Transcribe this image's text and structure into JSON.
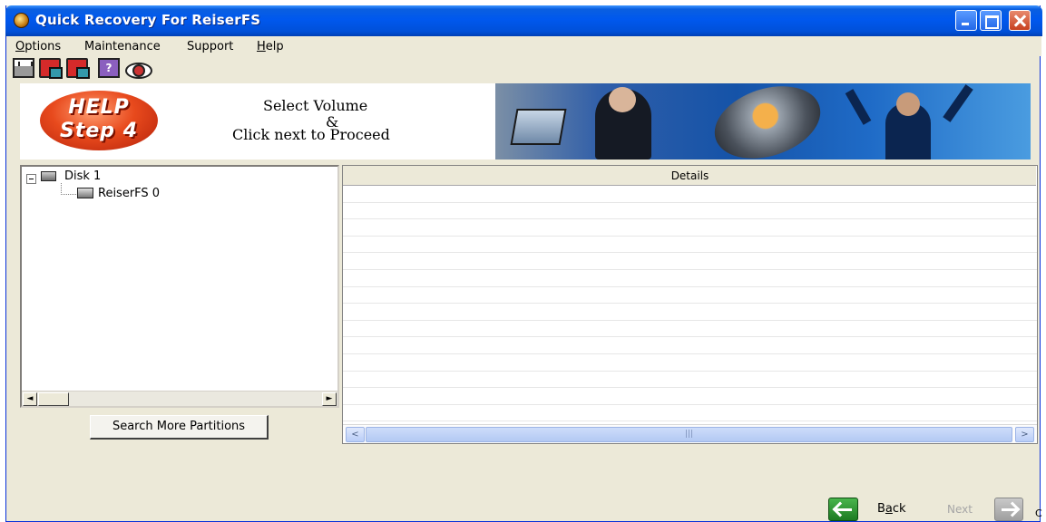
{
  "window": {
    "title": "Quick Recovery For ReiserFS"
  },
  "menu": {
    "items": [
      {
        "pre": "",
        "mnemonic": "O",
        "post": "ptions"
      },
      {
        "pre": "Maintenance",
        "mnemonic": "",
        "post": ""
      },
      {
        "pre": "Support",
        "mnemonic": "",
        "post": ""
      },
      {
        "pre": "",
        "mnemonic": "H",
        "post": "elp"
      }
    ]
  },
  "toolbar": {
    "help_glyph": "?"
  },
  "banner": {
    "badge_line1": "HELP",
    "badge_line2": "Step 4",
    "instruction_line1": "Select Volume",
    "instruction_line2": "&",
    "instruction_line3": "Click next to Proceed"
  },
  "tree": {
    "disk_label": "Disk 1",
    "partition_label": "ReiserFS 0"
  },
  "buttons": {
    "search_more": "Search More Partitions",
    "back_pre": "B",
    "back_mnemonic": "a",
    "back_post": "ck",
    "next": "Next"
  },
  "details": {
    "header": "Details",
    "scroll_grip": "|||"
  },
  "scroll_glyphs": {
    "left": "◄",
    "right": "►",
    "xp_left": "<",
    "xp_right": ">"
  },
  "corner_mark": "C"
}
